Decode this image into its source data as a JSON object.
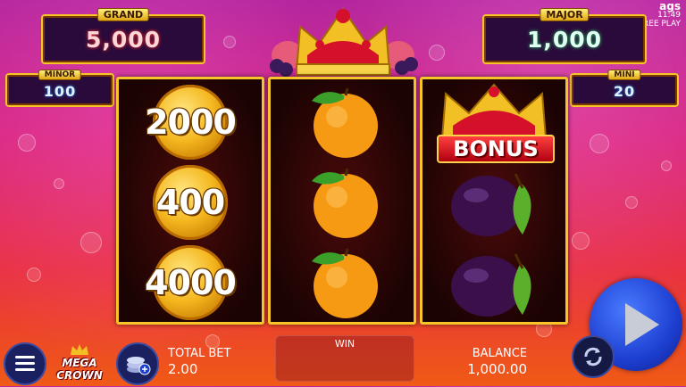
{
  "jackpots": {
    "grand": {
      "label": "GRAND",
      "value": "5,000"
    },
    "major": {
      "label": "MAJOR",
      "value": "1,000"
    },
    "minor": {
      "label": "MINOR",
      "value": "100"
    },
    "mini": {
      "label": "MINI",
      "value": "20"
    }
  },
  "provider": {
    "brand": "ags",
    "clock": "11:49",
    "mode": "FREE PLAY"
  },
  "reels": {
    "reel1": {
      "symbols": [
        "coin",
        "coin",
        "coin"
      ],
      "values": [
        "2000",
        "400",
        "4000"
      ]
    },
    "reel2": {
      "symbols": [
        "orange",
        "orange",
        "orange"
      ]
    },
    "reel3": {
      "symbols": [
        "bonus-crown",
        "plum",
        "plum"
      ],
      "bonus_label": "BONUS"
    }
  },
  "logo": {
    "text": "MEGA CROWN"
  },
  "bottom_bar": {
    "total_bet_label": "TOTAL BET",
    "total_bet_value": "2.00",
    "win_label": "WIN",
    "balance_label": "BALANCE",
    "balance_value": "1,000.00"
  },
  "icons": {
    "menu": "hamburger-menu-icon",
    "bet": "coin-stack-icon",
    "spin": "play-icon",
    "autoplay": "refresh-icon"
  },
  "colors": {
    "frame_gold": "#f7c52a",
    "spin_blue": "#1d3fd1"
  }
}
